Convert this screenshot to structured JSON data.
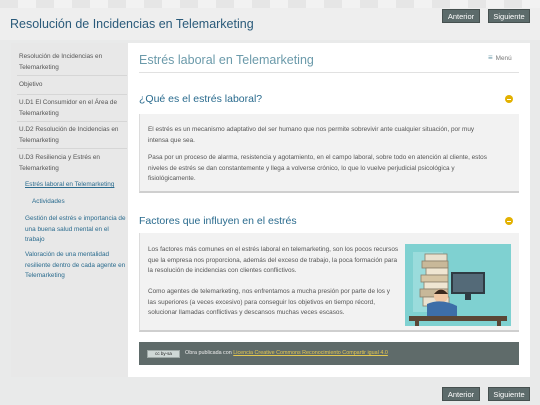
{
  "site_title": "Resolución de Incidencias en Telemarketing",
  "nav_buttons": {
    "prev": "Anterior",
    "next": "Siguiente"
  },
  "sidebar": {
    "items": [
      {
        "lines": [
          "Resolución de Incidencias en",
          "Telemarketing"
        ]
      },
      {
        "lines": [
          "Objetivo"
        ]
      },
      {
        "lines": [
          "U.D1 El Consumidor en el Área de",
          "Telemarketing"
        ]
      },
      {
        "lines": [
          "U.D2 Resolución de Incidencias en",
          "Telemarketing"
        ]
      },
      {
        "lines": [
          "U.D3 Resiliencia y Estrés en",
          "Telemarketing"
        ]
      },
      {
        "lines": [
          "Estrés laboral en Telemarketing"
        ]
      },
      {
        "lines": [
          "Actividades"
        ]
      },
      {
        "lines": [
          "Gestión del estrés e importancia de",
          "una buena salud mental en el",
          "trabajo"
        ]
      },
      {
        "lines": [
          "Valoración de una mentalidad",
          "resiliente dentro de cada agente en",
          "Telemarketing"
        ]
      }
    ]
  },
  "main": {
    "title": "Estrés laboral en Telemarketing",
    "menu_label": "Menú",
    "sections": [
      {
        "heading": "¿Qué es el estrés laboral?",
        "paragraphs": [
          [
            "El estrés es un mecanismo adaptativo del ser humano que nos permite sobrevivir ante cualquier situación, por muy",
            "intensa que sea."
          ],
          [
            "Pasa por un proceso de alarma, resistencia y agotamiento, en el campo laboral, sobre todo en atención al cliente, estos",
            "niveles de estrés se dan constantemente y llega a volverse crónico, lo que lo vuelve perjudicial psicológica y",
            "fisiológicamente."
          ]
        ]
      },
      {
        "heading": "Factores que influyen en el estrés",
        "paragraphs": [
          [
            "Los factores más comunes en el estrés laboral en telemarketing, son los pocos recursos",
            " que la empresa nos proporciona, además del exceso de trabajo, la poca formación para",
            "la resolución de incidencias con clientes conflictivos."
          ],
          [
            "Como agentes de telemarketing, nos enfrentamos a mucha presión por parte de los y",
            "las superiores (a veces excesivo) para conseguir los objetivos en tiempo récord,",
            "solucionar llamadas conflictivas y descansos muchas veces escasos."
          ]
        ]
      }
    ],
    "footer": {
      "badge": "cc by-sa",
      "prefix": "Obra publicada con ",
      "link": "Licencia Creative Commons Reconocimiento Compartir igual 4.0"
    }
  },
  "icons": [
    "hamburger-menu-icon",
    "collapse-toggle-icon",
    "stressed-worker-illustration",
    "cc-license-icon"
  ],
  "colors": {
    "accent": "#2a6b8e",
    "toggle": "#e3b100",
    "button": "#5c6b6b",
    "footer": "#5f6b6a"
  }
}
